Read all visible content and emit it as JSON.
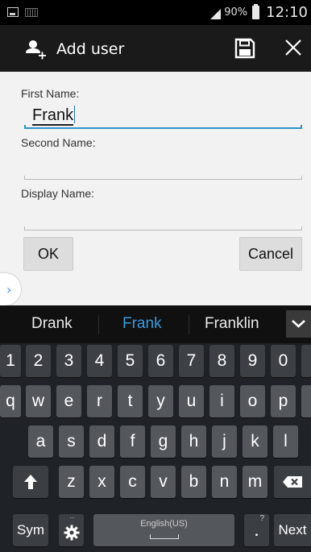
{
  "status_bar": {
    "battery": "90%",
    "time": "12:10"
  },
  "action_bar": {
    "title": "Add user"
  },
  "form": {
    "first_name": {
      "label": "First Name:",
      "value": "Frank"
    },
    "second_name": {
      "label": "Second Name:",
      "value": ""
    },
    "display_name": {
      "label": "Display Name:",
      "value": ""
    },
    "ok_label": "OK",
    "cancel_label": "Cancel"
  },
  "side_handle": "›",
  "suggestions": [
    "Drank",
    "Frank",
    "Franklin"
  ],
  "keyboard": {
    "numbers": [
      "1",
      "2",
      "3",
      "4",
      "5",
      "6",
      "7",
      "8",
      "9",
      "0"
    ],
    "row1": [
      "q",
      "w",
      "e",
      "r",
      "t",
      "y",
      "u",
      "i",
      "o",
      "p"
    ],
    "row2": [
      "a",
      "s",
      "d",
      "f",
      "g",
      "h",
      "j",
      "k",
      "l"
    ],
    "row3": [
      "z",
      "x",
      "c",
      "v",
      "b",
      "n",
      "m"
    ],
    "sym": "Sym",
    "settings_hint": "...",
    "space_label": "English(US)",
    "period": ".",
    "period_hint": "?",
    "next": "Next"
  },
  "colors": {
    "accent": "#2f95c8",
    "selected_suggestion": "#3b9be0"
  }
}
